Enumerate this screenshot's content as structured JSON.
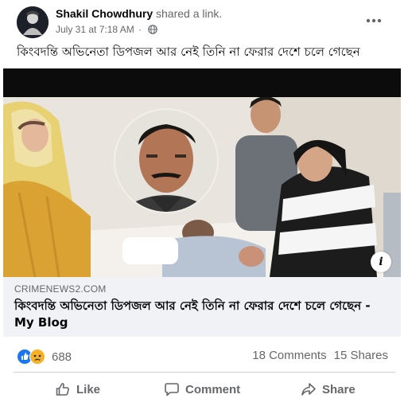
{
  "post": {
    "author": "Shakil Chowdhury",
    "action": "shared a link.",
    "timestamp": "July 31 at 7:18 AM",
    "separator": "·",
    "text": "কিংবদন্তি অভিনেতা ডিপজল আর নেই তিনি না ফেরার দেশে চলে গেছেন"
  },
  "link": {
    "domain": "CRIMENEWS2.COM",
    "title": "কিংবদন্তি অভিনেতা ডিপজল আর নেই তিনি না ফেরার দেশে চলে গেছেন - My Blog"
  },
  "engagement": {
    "reactions_count": "688",
    "comments": "18 Comments",
    "shares": "15 Shares"
  },
  "actions": {
    "like": "Like",
    "comment": "Comment",
    "share": "Share"
  },
  "icons": {
    "more": "more-horizontal-icon",
    "privacy": "globe-icon",
    "info": "info-icon",
    "reaction_like": "thumbs-up-reaction-icon",
    "reaction_sad": "sad-reaction-icon"
  },
  "colors": {
    "link_footer_bg": "#f0f2f5",
    "secondary_text": "#65676b",
    "like_blue": "#1877f2",
    "sad_yellow": "#f7b125"
  }
}
